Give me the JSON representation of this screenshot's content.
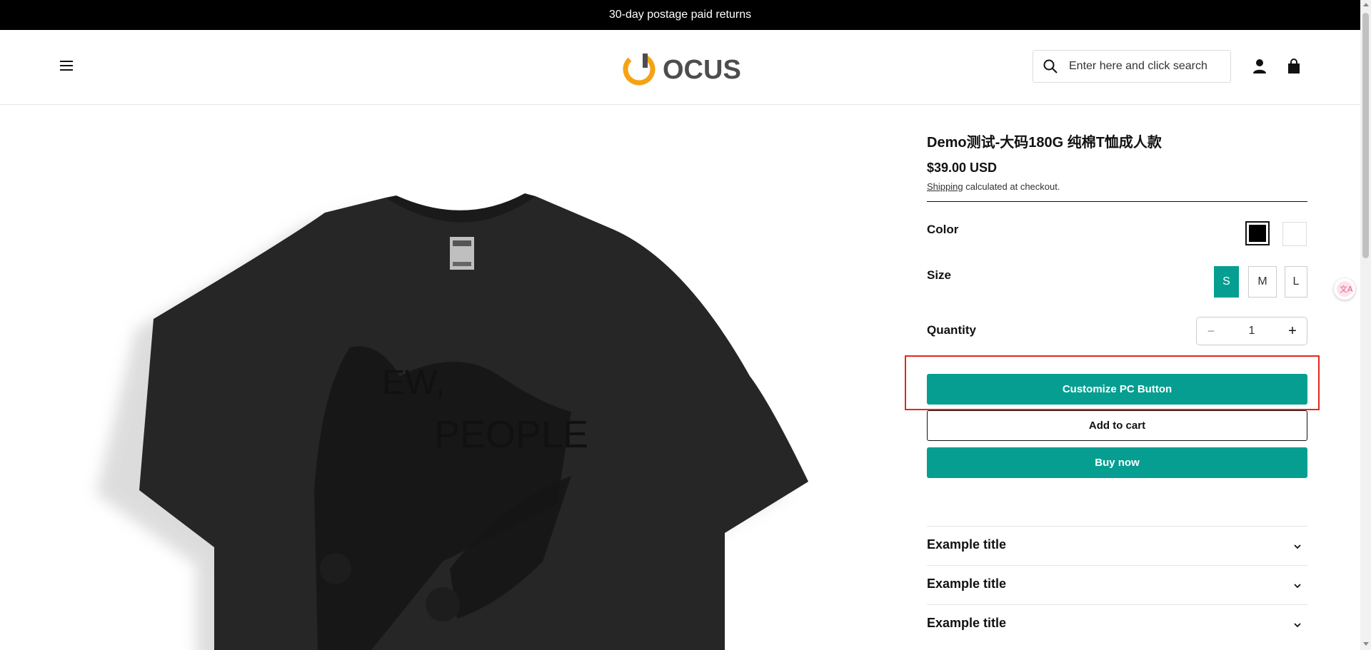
{
  "announcement": "30-day postage paid returns",
  "header": {
    "logo_text": "OCUS",
    "search_placeholder": "Enter here and click search"
  },
  "product": {
    "title": "Demo测试-大码180G 纯棉T恤成人款",
    "price": "$39.00 USD",
    "shipping_link": "Shipping",
    "shipping_note": " calculated at checkout.",
    "color_label": "Color",
    "colors": [
      "black",
      "white"
    ],
    "size_label": "Size",
    "sizes": [
      "S",
      "M",
      "L"
    ],
    "selected_size": "S",
    "quantity_label": "Quantity",
    "quantity": "1",
    "tshirt_print_line1": "EW,",
    "tshirt_print_line2": "PEOPLE"
  },
  "buttons": {
    "customize": "Customize PC Button",
    "add_to_cart": "Add to cart",
    "buy_now": "Buy now"
  },
  "accordions": [
    "Example title",
    "Example title",
    "Example title"
  ],
  "colors": {
    "accent": "#069e91",
    "announcement_bg": "#000000",
    "logo_orange": "#f5a314",
    "logo_gray": "#4d4d4d",
    "highlight": "#e0281e"
  }
}
